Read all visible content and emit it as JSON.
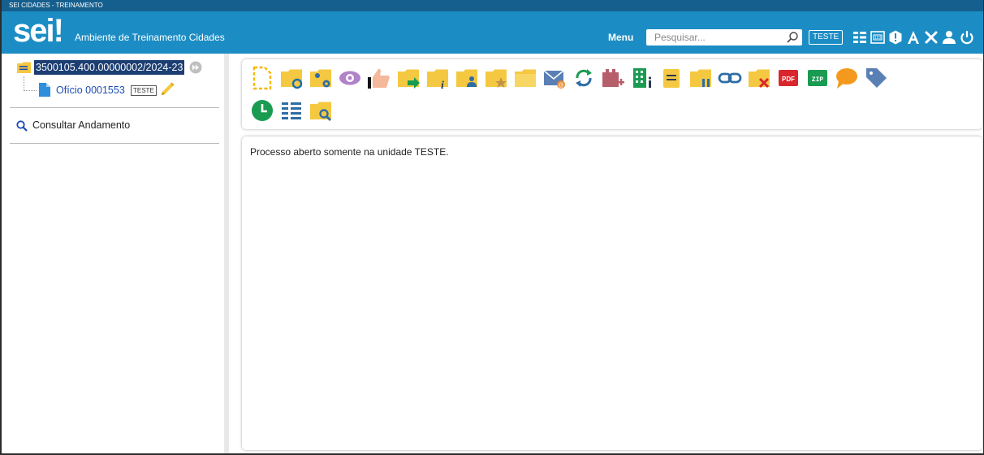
{
  "window": {
    "title": "SEI CIDADES - TREINAMENTO"
  },
  "header": {
    "logo": "sei",
    "logo_mark": "!",
    "environment": "Ambiente de Treinamento Cidades",
    "menu_label": "Menu",
    "search_placeholder": "Pesquisar...",
    "unit_badge": "TESTE",
    "icons": [
      "search-icon",
      "list-view-icon",
      "numbering-icon",
      "alert-icon",
      "font-size-icon",
      "tools-icon",
      "user-icon",
      "power-icon"
    ]
  },
  "tree": {
    "process_number": "3500105.400.00000002/2024-23",
    "document_label": "Ofício 0001553",
    "document_unit": "TESTE",
    "consult_label": "Consultar Andamento"
  },
  "toolbar": {
    "icons": [
      "new-document-icon",
      "follow-process-icon",
      "process-settings-icon",
      "view-icon",
      "hand-like-icon",
      "send-process-icon",
      "process-info-icon",
      "assign-process-icon",
      "favorite-process-icon",
      "folder-icon",
      "send-email-icon",
      "refresh-icon",
      "add-block-icon",
      "units-icon",
      "note-icon",
      "suspend-process-icon",
      "link-process-icon",
      "close-process-icon",
      "pdf-icon",
      "zip-icon",
      "comment-icon",
      "tag-icon",
      "history-clock-icon",
      "list-tree-icon",
      "search-folder-icon"
    ]
  },
  "content": {
    "message": "Processo aberto somente na unidade TESTE."
  },
  "colors": {
    "header_bg": "#1c8dc4",
    "topstrip_bg": "#155f8e",
    "selection_bg": "#1c3e72",
    "folder_yellow": "#f5c842",
    "link_blue": "#1b4db3"
  }
}
